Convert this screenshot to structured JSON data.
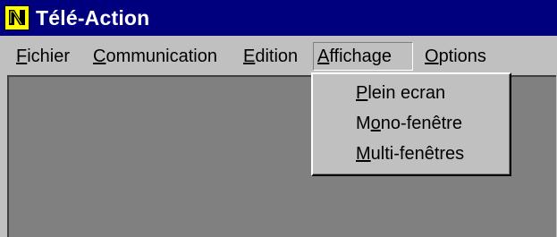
{
  "window": {
    "title": "Télé-Action",
    "icon": "app-logo-icon"
  },
  "menubar": {
    "items": [
      {
        "pre": "",
        "key": "F",
        "post": "ichier"
      },
      {
        "pre": "",
        "key": "C",
        "post": "ommunication"
      },
      {
        "pre": "",
        "key": "E",
        "post": "dition"
      },
      {
        "pre": "",
        "key": "A",
        "post": "ffichage"
      },
      {
        "pre": "",
        "key": "O",
        "post": "ptions"
      }
    ],
    "open_menu": "Affichage"
  },
  "dropdown": {
    "items": [
      {
        "pre": "",
        "key": "P",
        "post": "lein ecran"
      },
      {
        "pre": "M",
        "key": "o",
        "post": "no-fenêtre"
      },
      {
        "pre": "",
        "key": "M",
        "post": "ulti-fenêtres"
      }
    ]
  },
  "colors": {
    "titlebar": "#00007f",
    "face": "#c0c0c0",
    "client": "#808080",
    "icon_bg": "#ffff00"
  }
}
